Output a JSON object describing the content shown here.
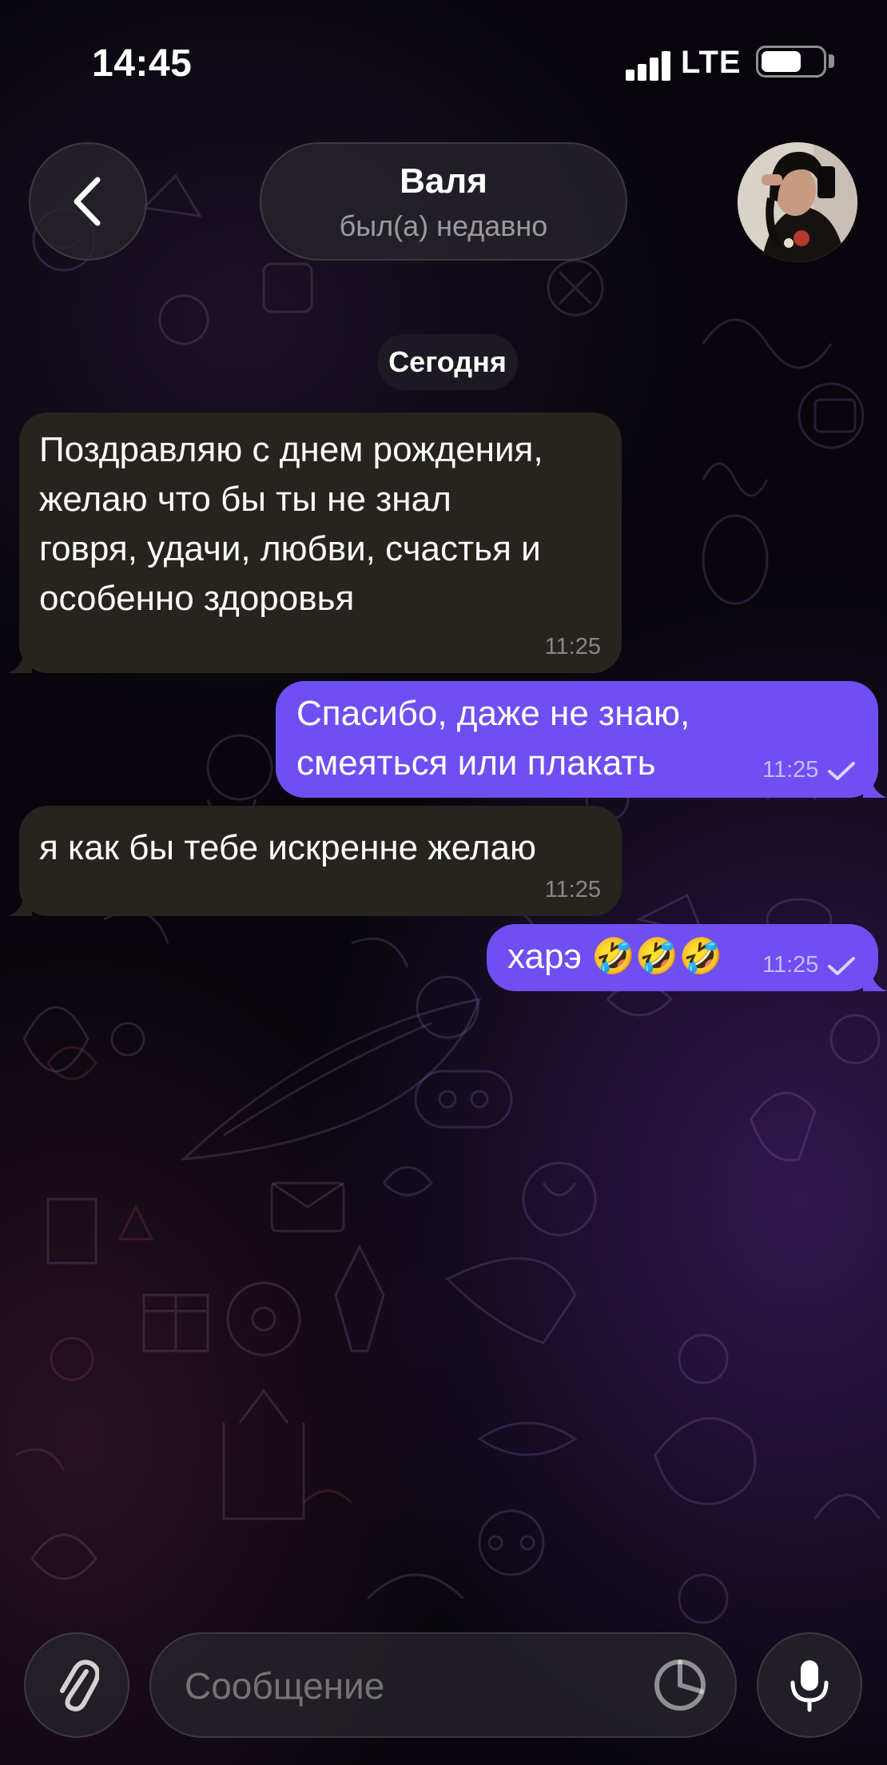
{
  "status_bar": {
    "time": "14:45",
    "network": "LTE",
    "battery_level": 0.65,
    "signal_bars": 4
  },
  "header": {
    "contact_name": "Валя",
    "contact_status": "был(а) недавно",
    "back_icon": "chevron-left-icon",
    "avatar": "contact-avatar-photo"
  },
  "chat": {
    "date_separator": "Сегодня",
    "messages": [
      {
        "direction": "incoming",
        "text": "Поздравляю с днем рождения,\nжелаю что бы ты не знал\nговря, удачи, любви, счастья и\nособенно здоровья",
        "time": "11:25"
      },
      {
        "direction": "outgoing",
        "text": "Спасибо, даже не знаю,\nсмеяться или плакать",
        "time": "11:25",
        "read": true
      },
      {
        "direction": "incoming",
        "text": "я как бы тебе искренне желаю",
        "time": "11:25"
      },
      {
        "direction": "outgoing",
        "text": "харэ 🤣🤣🤣",
        "time": "11:25",
        "read": true
      }
    ]
  },
  "composer": {
    "placeholder": "Сообщение",
    "value": "",
    "attach_icon": "paperclip-icon",
    "sticker_icon": "sticker-icon",
    "mic_icon": "microphone-icon"
  },
  "colors": {
    "outgoing_bubble": "#6f4ef2",
    "incoming_bubble": "#27241f",
    "background": "#08060c"
  }
}
